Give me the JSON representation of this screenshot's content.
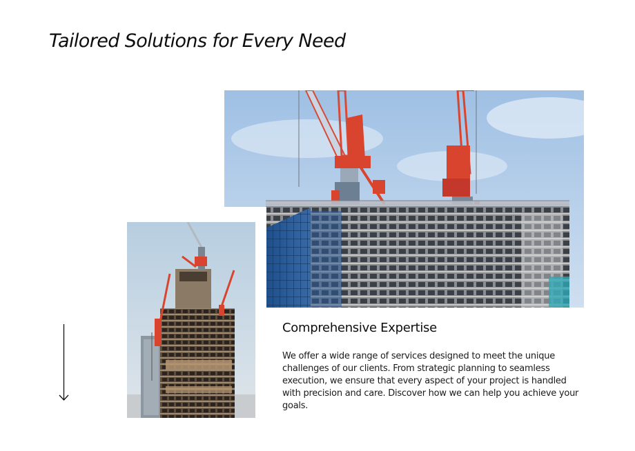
{
  "page": {
    "title": "Tailored Solutions for Every Need"
  },
  "section": {
    "heading": "Comprehensive Expertise",
    "body": "We offer a wide range of services designed to meet the unique challenges of our clients. From strategic planning to seamless execution, we ensure that every aspect of your project is handled with precision and care. Discover how we can help you achieve your goals."
  },
  "icons": {
    "scroll_down": "arrow-down-icon"
  },
  "colors": {
    "text": "#0d0d0d",
    "background": "#ffffff",
    "crane_red": "#d8442e",
    "sky_blue": "#a9c8e8",
    "glass_blue": "#2d5a94"
  }
}
